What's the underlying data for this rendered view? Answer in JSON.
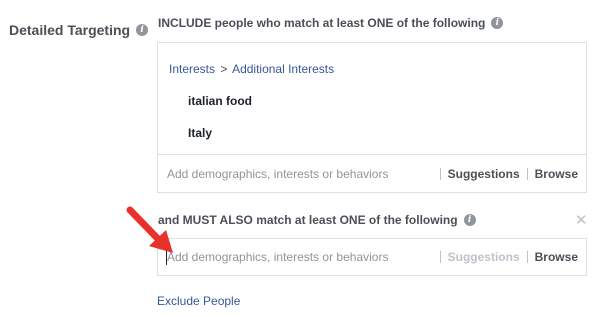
{
  "detailed_targeting": {
    "label": "Detailed Targeting",
    "info_icon": "info-icon"
  },
  "include": {
    "header": "INCLUDE people who match at least ONE of the following",
    "breadcrumb": {
      "parent": "Interests",
      "separator": ">",
      "child": "Additional Interests"
    },
    "tags": [
      "italian food",
      "Italy"
    ],
    "search_placeholder": "Add demographics, interests or behaviors",
    "suggestions_label": "Suggestions",
    "browse_label": "Browse"
  },
  "must_also": {
    "header": "and MUST ALSO match at least ONE of the following",
    "close_icon": "close-icon",
    "search_placeholder": "Add demographics, interests or behaviors",
    "suggestions_label": "Suggestions",
    "suggestions_disabled": true,
    "browse_label": "Browse"
  },
  "exclude_label": "Exclude People",
  "annotation": {
    "arrow_color": "#e8312a"
  },
  "colors": {
    "link": "#365899",
    "text": "#4b4f56",
    "border": "#dddfe2",
    "muted": "#90949c"
  }
}
